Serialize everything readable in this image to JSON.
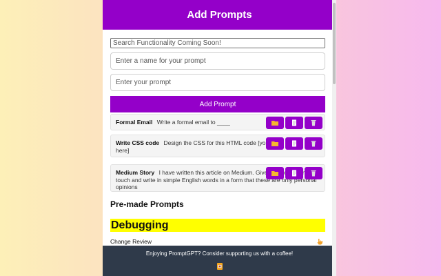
{
  "header": {
    "title": "Add Prompts"
  },
  "form": {
    "search_placeholder": "Search Functionality Coming Soon!",
    "name_placeholder": "Enter a name for your prompt",
    "prompt_placeholder": "Enter your prompt",
    "add_button": "Add Prompt"
  },
  "prompts": [
    {
      "name": "Formal Email",
      "text": "Write a formal email to ____"
    },
    {
      "name": "Write CSS code",
      "text": "Design the CSS for this HTML code [your HTML code here]"
    },
    {
      "name": "Medium Story",
      "text": "I have written this article on Medium. Give it a professional touch and write in simple English words in a form that these are only personal opinions"
    }
  ],
  "premade": {
    "title": "Pre-made Prompts",
    "category": "Debugging",
    "items": [
      {
        "label": "Change Review"
      }
    ]
  },
  "footer": {
    "text": "Enjoying PromptGPT? Consider supporting us with a coffee!"
  },
  "colors": {
    "accent": "#9400c9",
    "category_bg": "#ffff00",
    "footer_bg": "#2f3a4a"
  },
  "icons": {
    "open": "folder-icon",
    "copy": "document-icon",
    "delete": "trash-icon",
    "coffee": "coffee-cup-icon",
    "pointer": "pointer-hand-icon"
  }
}
